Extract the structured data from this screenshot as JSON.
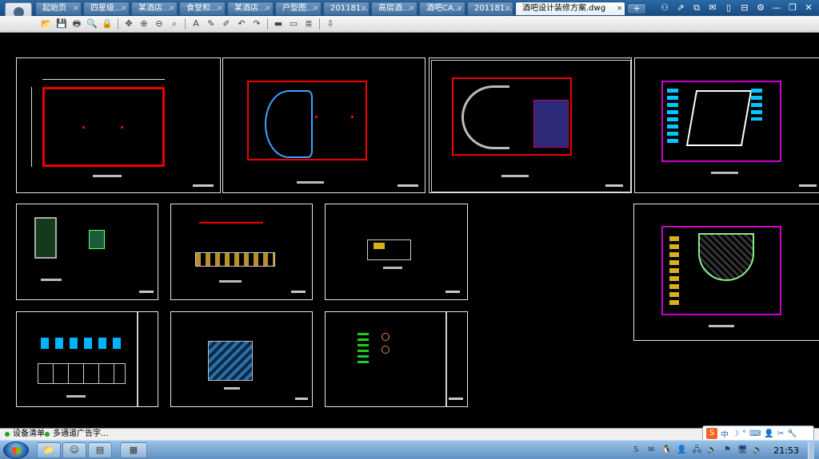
{
  "tabs": [
    {
      "label": "起始页"
    },
    {
      "label": "四星级..."
    },
    {
      "label": "某酒店..."
    },
    {
      "label": "食堂和..."
    },
    {
      "label": "某酒店..."
    },
    {
      "label": "户型图..."
    },
    {
      "label": "201181..."
    },
    {
      "label": "高层酒..."
    },
    {
      "label": "酒吧CA..."
    },
    {
      "label": "201181..."
    }
  ],
  "active_tab": {
    "label": "酒吧设计装修方案.dwg"
  },
  "tab_close_glyph": "✕",
  "tab_add_label": "+",
  "sys_icons": [
    "users-icon",
    "share-icon",
    "screen-icon",
    "message-icon",
    "phone-icon",
    "collapse-icon",
    "gear-icon",
    "minimize-icon",
    "restore-icon",
    "close-icon"
  ],
  "sys_glyphs": [
    "⚇",
    "⇗",
    "⧉",
    "✉",
    "▯",
    "⊟",
    "⚙",
    "—",
    "❐",
    "✕"
  ],
  "toolbar": {
    "icons": [
      "open-icon",
      "save-icon",
      "print-icon",
      "print-preview-icon",
      "lock-icon",
      "pan-icon",
      "zoom-in-icon",
      "zoom-out-icon",
      "zoom-window-icon",
      "text-icon",
      "pencil-icon",
      "highlight-icon",
      "undo-icon",
      "redo-icon",
      "layer-bar-icon",
      "measure-icon",
      "layers-icon",
      "export-icon"
    ],
    "glyphs": [
      "📂",
      "💾",
      "🖶",
      "🔍",
      "🔒",
      "✥",
      "⊕",
      "⊖",
      "⌕",
      "A",
      "✎",
      "✐",
      "↶",
      "↷",
      "▬",
      "▭",
      "≣",
      "⇩"
    ]
  },
  "status_tabs": [
    {
      "label": "设备清单"
    },
    {
      "label": "多通道广告字..."
    }
  ],
  "ime": {
    "logo": "S",
    "lang": "中",
    "symbols": [
      "☽",
      "°",
      "⌨",
      "👤",
      "✂",
      "🔧"
    ]
  },
  "taskbar": {
    "buttons": [
      "folder-icon",
      "avatar-icon",
      "stack-icon",
      "cad-icon"
    ],
    "glyphs": [
      "📁",
      "☺",
      "▤",
      "▦"
    ],
    "tray_icons": [
      "sogou-icon",
      "chat-icon",
      "qq-icon",
      "user-icon",
      "network-icon",
      "volume-icon",
      "flag-icon",
      "monitor-icon",
      "speaker-icon"
    ],
    "tray_glyphs": [
      "S",
      "✉",
      "🐧",
      "👤",
      "🖧",
      "🔊",
      "⚑",
      "🖥",
      "🔈"
    ],
    "clock": "21:53"
  },
  "colors": {
    "accent": "#1e5a96",
    "drawing_red": "#e00000",
    "background": "#000000"
  }
}
